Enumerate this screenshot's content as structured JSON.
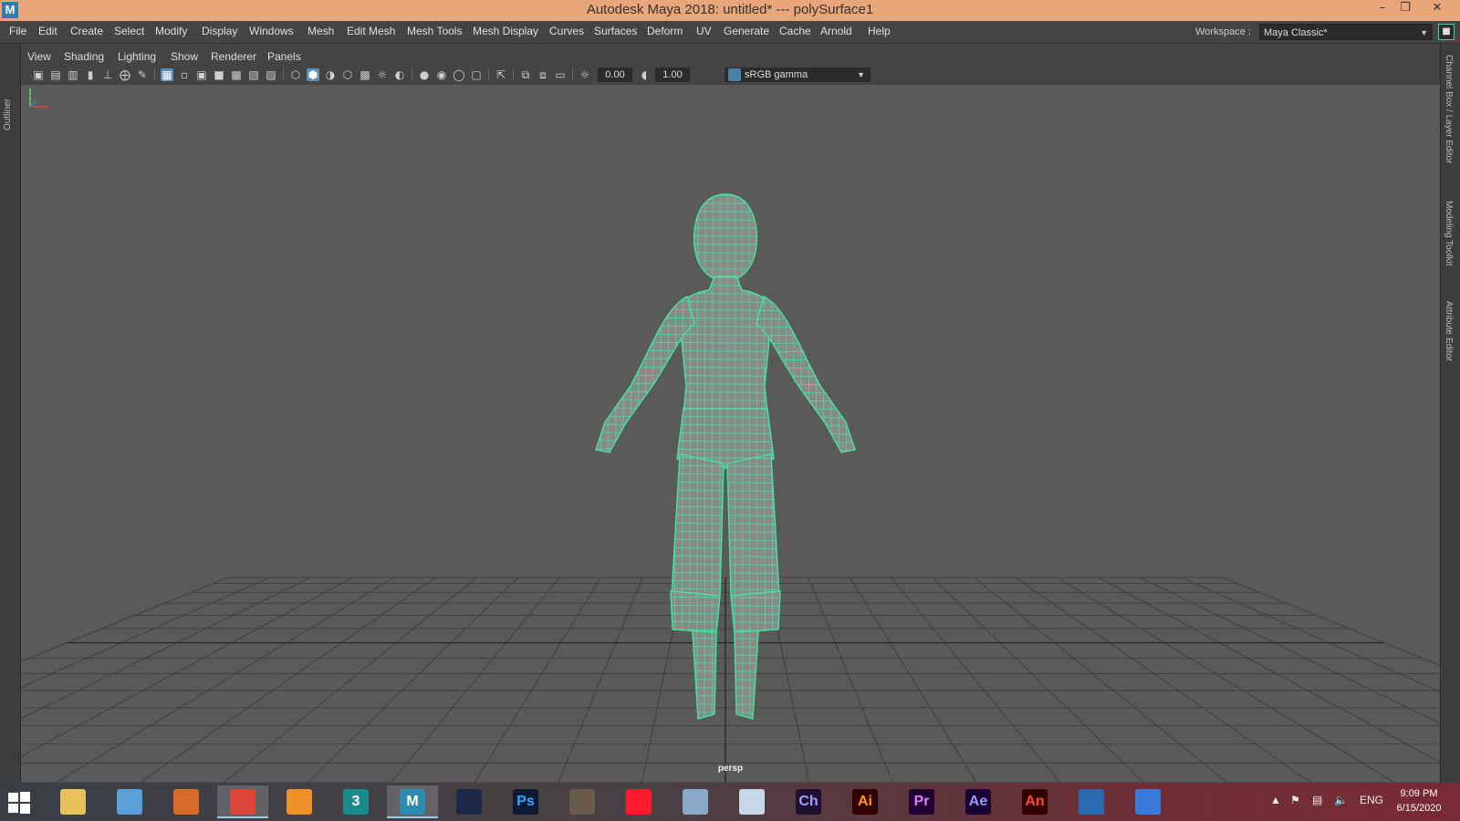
{
  "window": {
    "app_logo": "M",
    "title": "Autodesk Maya 2018: untitled*   ---   polySurface1",
    "controls": {
      "minimize": "–",
      "restore": "❐",
      "close": "✕"
    }
  },
  "menubar": {
    "items": [
      "File",
      "Edit",
      "Create",
      "Select",
      "Modify",
      "Display",
      "Windows",
      "Mesh",
      "Edit Mesh",
      "Mesh Tools",
      "Mesh Display",
      "Curves",
      "Surfaces",
      "Deform",
      "UV",
      "Generate",
      "Cache",
      "Arnold",
      "Help"
    ],
    "workspace_label": "Workspace :",
    "workspace_value": "Maya Classic*"
  },
  "side_tabs": {
    "left": "Outliner",
    "right": [
      "Channel Box / Layer Editor",
      "Modeling Toolkit",
      "Attribute Editor"
    ]
  },
  "panel": {
    "menus": [
      "View",
      "Shading",
      "Lighting",
      "Show",
      "Renderer",
      "Panels"
    ],
    "exposure": "0.00",
    "gamma": "1.00",
    "color_space": "sRGB gamma",
    "camera": "persp"
  },
  "taskbar": {
    "apps": [
      {
        "name": "file-explorer",
        "label": "",
        "color": "#e8c15a",
        "fg": "#5a4a10"
      },
      {
        "name": "file-manager",
        "label": "",
        "color": "#5aa0d8",
        "fg": "#fff"
      },
      {
        "name": "fruity-loops",
        "label": "",
        "color": "#d86a2a",
        "fg": "#fff"
      },
      {
        "name": "chrome",
        "label": "",
        "color": "#db4437",
        "fg": "#fff"
      },
      {
        "name": "blender",
        "label": "",
        "color": "#f0902a",
        "fg": "#fff"
      },
      {
        "name": "3ds-max",
        "label": "3",
        "color": "#1a8a8a",
        "fg": "#fff"
      },
      {
        "name": "maya",
        "label": "M",
        "color": "#2a8ab0",
        "fg": "#fff"
      },
      {
        "name": "cinema4d",
        "label": "",
        "color": "#1c2a48",
        "fg": "#fff"
      },
      {
        "name": "photoshop",
        "label": "Ps",
        "color": "#0c1a33",
        "fg": "#31a8ff"
      },
      {
        "name": "gimp",
        "label": "",
        "color": "#6a5a4a",
        "fg": "#fff"
      },
      {
        "name": "opera",
        "label": "",
        "color": "#ff1b2d",
        "fg": "#fff"
      },
      {
        "name": "screen-app",
        "label": "",
        "color": "#8aa8c8",
        "fg": "#fff"
      },
      {
        "name": "image-viewer",
        "label": "",
        "color": "#c8d8e8",
        "fg": "#333"
      },
      {
        "name": "character-animator",
        "label": "Ch",
        "color": "#1e0e2f",
        "fg": "#a79cff"
      },
      {
        "name": "illustrator",
        "label": "Ai",
        "color": "#330000",
        "fg": "#ff9a00"
      },
      {
        "name": "premiere",
        "label": "Pr",
        "color": "#1e0033",
        "fg": "#e77bff"
      },
      {
        "name": "after-effects",
        "label": "Ae",
        "color": "#1a0033",
        "fg": "#9999ff"
      },
      {
        "name": "animate",
        "label": "An",
        "color": "#330000",
        "fg": "#ff4b33"
      },
      {
        "name": "blue-app",
        "label": "",
        "color": "#2a6ab0",
        "fg": "#fff"
      },
      {
        "name": "arrow-app",
        "label": "",
        "color": "#3a7ad8",
        "fg": "#fff"
      }
    ],
    "tray_chevron": "▲",
    "language": "ENG",
    "time": "9:09 PM",
    "date": "6/15/2020"
  }
}
